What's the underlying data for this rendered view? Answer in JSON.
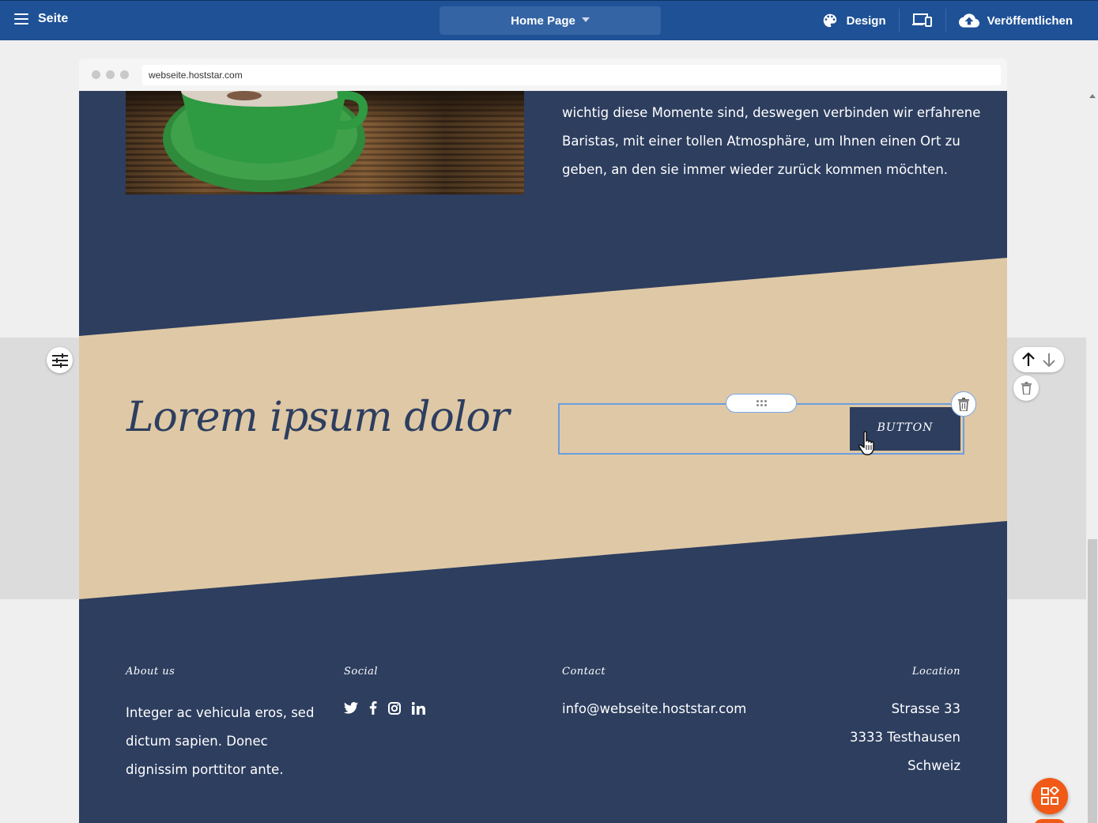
{
  "topbar": {
    "menu_label": "Seite",
    "page_selector": "Home Page",
    "design_label": "Design",
    "publish_label": "Veröffentlichen"
  },
  "browser": {
    "url": "webseite.hoststar.com"
  },
  "intro": {
    "text": "wichtig diese Momente sind, deswegen verbinden wir erfahrene Baristas, mit einer tollen Atmosphäre, um Ihnen einen Ort zu geben, an den sie immer wieder zurück kommen möchten."
  },
  "cta_section": {
    "heading": "Lorem ipsum dolor",
    "button_label": "BUTTON"
  },
  "footer": {
    "about": {
      "heading": "About us",
      "text": "Integer ac vehicula eros, sed dictum sapien. Donec dignissim porttitor ante."
    },
    "social": {
      "heading": "Social",
      "icons": [
        "twitter-icon",
        "facebook-icon",
        "instagram-icon",
        "linkedin-icon"
      ]
    },
    "contact": {
      "heading": "Contact",
      "email": "info@webseite.hoststar.com"
    },
    "location": {
      "heading": "Location",
      "lines": [
        "Strasse 33",
        "3333 Testhausen",
        "Schweiz"
      ]
    }
  },
  "colors": {
    "topbar": "#1f5196",
    "site_navy": "#2d3e5f",
    "band_beige": "#dfc8a5",
    "accent_orange": "#f05a16",
    "selection_blue": "#6b9de0"
  }
}
